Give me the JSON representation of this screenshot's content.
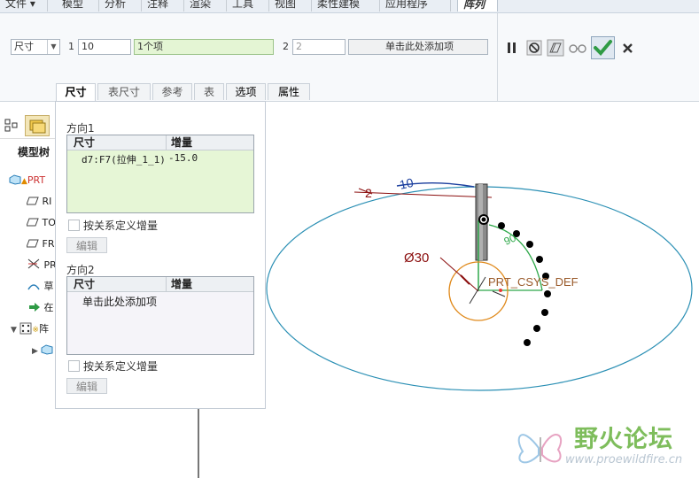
{
  "menubar": {
    "tabs": [
      "文件",
      "模型",
      "分析",
      "注释",
      "渲染",
      "工具",
      "视图",
      "柔性建模",
      "应用程序",
      "阵列"
    ],
    "active": "阵列"
  },
  "ribbon": {
    "type_select": "尺寸",
    "dir1_label": "1",
    "dir1_count": "10",
    "dir1_items": "1个项",
    "dir2_label": "2",
    "dir2_count": "2",
    "dir2_items": "单击此处添加项",
    "accent": "#2f9b45"
  },
  "subtabs": [
    "尺寸",
    "表尺寸",
    "参考",
    "表",
    "选项",
    "属性"
  ],
  "tree": {
    "header": "模型树",
    "items": [
      "PRT",
      "RI",
      "TO",
      "FR",
      "PR",
      "草",
      "在",
      "阵",
      ""
    ]
  },
  "panel": {
    "dir1_title": "方向1",
    "dir2_title": "方向2",
    "col_dim": "尺寸",
    "col_inc": "增量",
    "dir1_rows": [
      {
        "dim": "d7:F7(拉伸_1_1)",
        "inc": "-15.0"
      }
    ],
    "dir2_placeholder": "单击此处添加项",
    "relation_label": "按关系定义增量",
    "edit_button": "编辑"
  },
  "canvas": {
    "dim_2": "2",
    "dim_10": "10",
    "dim_90": "90",
    "diameter": "Ø30",
    "csys": "PRT_CSYS_DEF"
  },
  "watermark": {
    "name": "野火论坛",
    "url": "www.proewildfire.cn"
  }
}
